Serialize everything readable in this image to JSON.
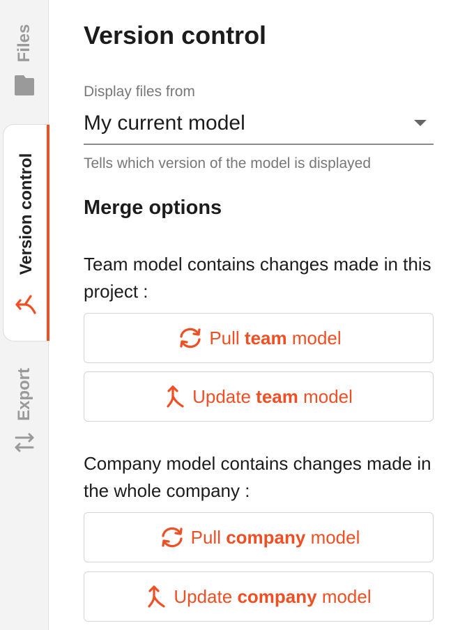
{
  "sidebar": {
    "tabs": [
      {
        "label": "Files",
        "icon": "folder-icon",
        "active": false
      },
      {
        "label": "Version control",
        "icon": "merge-icon",
        "active": true
      },
      {
        "label": "Export",
        "icon": "swap-arrows-icon",
        "active": false
      }
    ]
  },
  "panel": {
    "title": "Version control",
    "display": {
      "label": "Display files from",
      "value": "My current model",
      "helper": "Tells which version of the model is displayed"
    },
    "merge": {
      "heading": "Merge options",
      "team": {
        "description": "Team model contains changes made in this project :",
        "pull": {
          "prefix": "Pull ",
          "bold": "team",
          "suffix": " model",
          "icon": "sync-icon"
        },
        "update": {
          "prefix": "Update ",
          "bold": "team",
          "suffix": " model",
          "icon": "merge-up-icon"
        }
      },
      "company": {
        "description": "Company model contains changes made in the whole company :",
        "pull": {
          "prefix": "Pull ",
          "bold": "company",
          "suffix": " model",
          "icon": "sync-icon"
        },
        "update": {
          "prefix": "Update ",
          "bold": "company",
          "suffix": " model",
          "icon": "merge-up-icon"
        }
      }
    }
  },
  "colors": {
    "accent": "#f04e23",
    "inactive": "#9a9a9a",
    "rail_bg": "#f3f3f3"
  }
}
